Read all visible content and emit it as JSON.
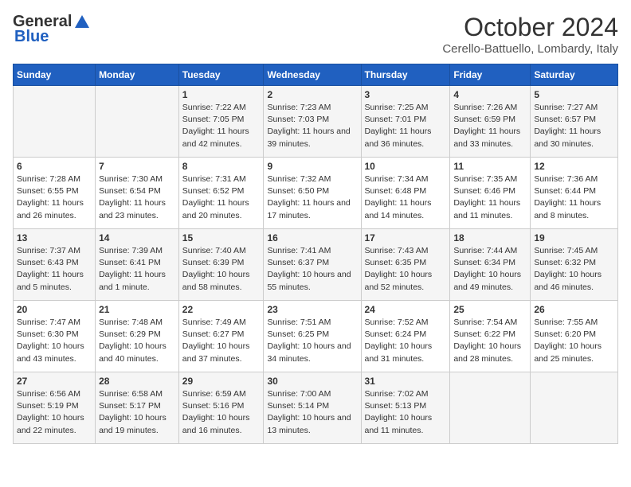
{
  "logo": {
    "general": "General",
    "blue": "Blue"
  },
  "title": "October 2024",
  "location": "Cerello-Battuello, Lombardy, Italy",
  "days_of_week": [
    "Sunday",
    "Monday",
    "Tuesday",
    "Wednesday",
    "Thursday",
    "Friday",
    "Saturday"
  ],
  "weeks": [
    [
      {
        "day": "",
        "content": ""
      },
      {
        "day": "",
        "content": ""
      },
      {
        "day": "1",
        "content": "Sunrise: 7:22 AM\nSunset: 7:05 PM\nDaylight: 11 hours and 42 minutes."
      },
      {
        "day": "2",
        "content": "Sunrise: 7:23 AM\nSunset: 7:03 PM\nDaylight: 11 hours and 39 minutes."
      },
      {
        "day": "3",
        "content": "Sunrise: 7:25 AM\nSunset: 7:01 PM\nDaylight: 11 hours and 36 minutes."
      },
      {
        "day": "4",
        "content": "Sunrise: 7:26 AM\nSunset: 6:59 PM\nDaylight: 11 hours and 33 minutes."
      },
      {
        "day": "5",
        "content": "Sunrise: 7:27 AM\nSunset: 6:57 PM\nDaylight: 11 hours and 30 minutes."
      }
    ],
    [
      {
        "day": "6",
        "content": "Sunrise: 7:28 AM\nSunset: 6:55 PM\nDaylight: 11 hours and 26 minutes."
      },
      {
        "day": "7",
        "content": "Sunrise: 7:30 AM\nSunset: 6:54 PM\nDaylight: 11 hours and 23 minutes."
      },
      {
        "day": "8",
        "content": "Sunrise: 7:31 AM\nSunset: 6:52 PM\nDaylight: 11 hours and 20 minutes."
      },
      {
        "day": "9",
        "content": "Sunrise: 7:32 AM\nSunset: 6:50 PM\nDaylight: 11 hours and 17 minutes."
      },
      {
        "day": "10",
        "content": "Sunrise: 7:34 AM\nSunset: 6:48 PM\nDaylight: 11 hours and 14 minutes."
      },
      {
        "day": "11",
        "content": "Sunrise: 7:35 AM\nSunset: 6:46 PM\nDaylight: 11 hours and 11 minutes."
      },
      {
        "day": "12",
        "content": "Sunrise: 7:36 AM\nSunset: 6:44 PM\nDaylight: 11 hours and 8 minutes."
      }
    ],
    [
      {
        "day": "13",
        "content": "Sunrise: 7:37 AM\nSunset: 6:43 PM\nDaylight: 11 hours and 5 minutes."
      },
      {
        "day": "14",
        "content": "Sunrise: 7:39 AM\nSunset: 6:41 PM\nDaylight: 11 hours and 1 minute."
      },
      {
        "day": "15",
        "content": "Sunrise: 7:40 AM\nSunset: 6:39 PM\nDaylight: 10 hours and 58 minutes."
      },
      {
        "day": "16",
        "content": "Sunrise: 7:41 AM\nSunset: 6:37 PM\nDaylight: 10 hours and 55 minutes."
      },
      {
        "day": "17",
        "content": "Sunrise: 7:43 AM\nSunset: 6:35 PM\nDaylight: 10 hours and 52 minutes."
      },
      {
        "day": "18",
        "content": "Sunrise: 7:44 AM\nSunset: 6:34 PM\nDaylight: 10 hours and 49 minutes."
      },
      {
        "day": "19",
        "content": "Sunrise: 7:45 AM\nSunset: 6:32 PM\nDaylight: 10 hours and 46 minutes."
      }
    ],
    [
      {
        "day": "20",
        "content": "Sunrise: 7:47 AM\nSunset: 6:30 PM\nDaylight: 10 hours and 43 minutes."
      },
      {
        "day": "21",
        "content": "Sunrise: 7:48 AM\nSunset: 6:29 PM\nDaylight: 10 hours and 40 minutes."
      },
      {
        "day": "22",
        "content": "Sunrise: 7:49 AM\nSunset: 6:27 PM\nDaylight: 10 hours and 37 minutes."
      },
      {
        "day": "23",
        "content": "Sunrise: 7:51 AM\nSunset: 6:25 PM\nDaylight: 10 hours and 34 minutes."
      },
      {
        "day": "24",
        "content": "Sunrise: 7:52 AM\nSunset: 6:24 PM\nDaylight: 10 hours and 31 minutes."
      },
      {
        "day": "25",
        "content": "Sunrise: 7:54 AM\nSunset: 6:22 PM\nDaylight: 10 hours and 28 minutes."
      },
      {
        "day": "26",
        "content": "Sunrise: 7:55 AM\nSunset: 6:20 PM\nDaylight: 10 hours and 25 minutes."
      }
    ],
    [
      {
        "day": "27",
        "content": "Sunrise: 6:56 AM\nSunset: 5:19 PM\nDaylight: 10 hours and 22 minutes."
      },
      {
        "day": "28",
        "content": "Sunrise: 6:58 AM\nSunset: 5:17 PM\nDaylight: 10 hours and 19 minutes."
      },
      {
        "day": "29",
        "content": "Sunrise: 6:59 AM\nSunset: 5:16 PM\nDaylight: 10 hours and 16 minutes."
      },
      {
        "day": "30",
        "content": "Sunrise: 7:00 AM\nSunset: 5:14 PM\nDaylight: 10 hours and 13 minutes."
      },
      {
        "day": "31",
        "content": "Sunrise: 7:02 AM\nSunset: 5:13 PM\nDaylight: 10 hours and 11 minutes."
      },
      {
        "day": "",
        "content": ""
      },
      {
        "day": "",
        "content": ""
      }
    ]
  ]
}
